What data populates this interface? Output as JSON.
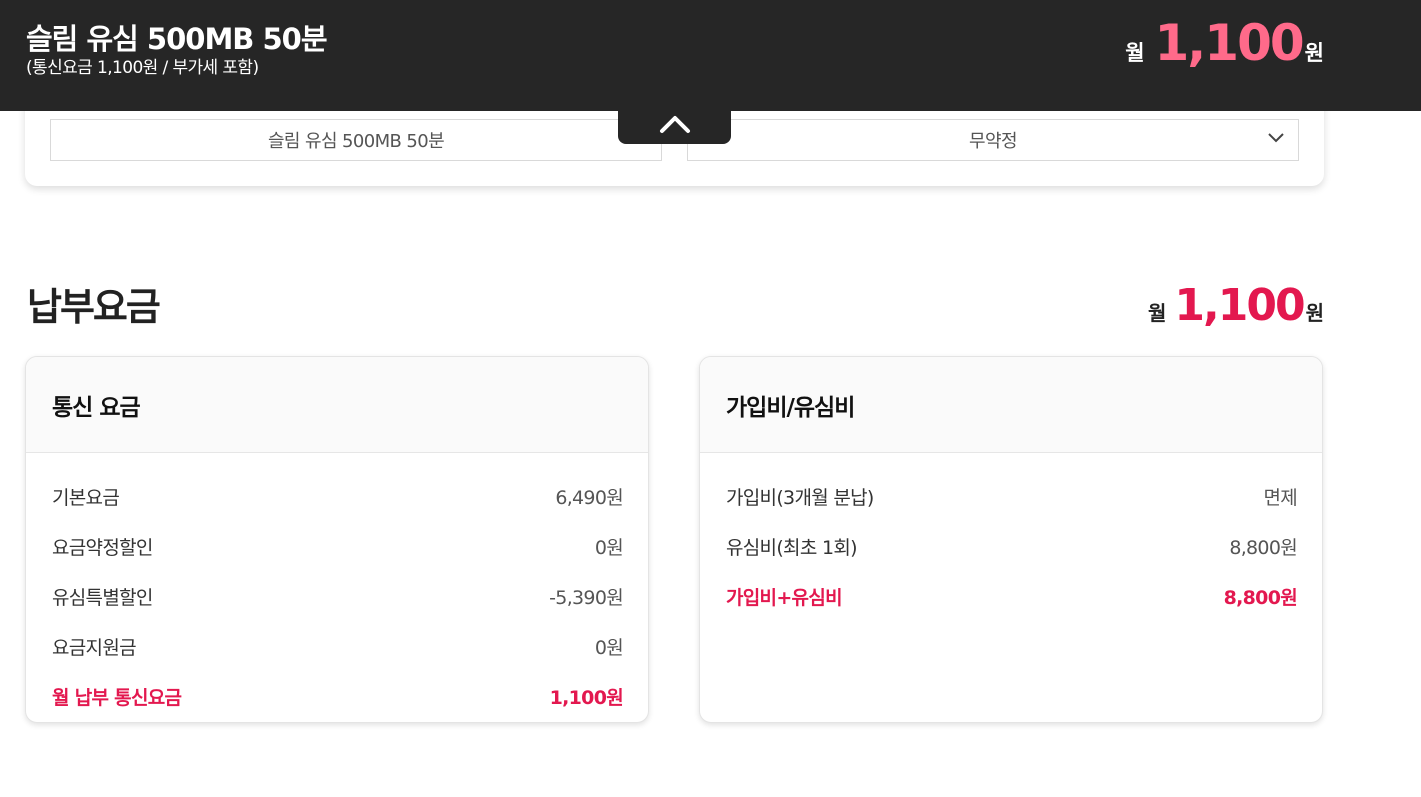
{
  "topbar": {
    "plan_name": "슬림 유심 500MB 50분",
    "plan_sub": "(통신요금 1,100원 / 부가세 포함)",
    "price_prefix": "월",
    "price_amount": "1,100",
    "price_unit": "원"
  },
  "selectors": {
    "plan": "슬림 유심 500MB 50분",
    "contract": "무약정"
  },
  "payment": {
    "title": "납부요금",
    "price_prefix": "월",
    "price_amount": "1,100",
    "price_unit": "원"
  },
  "telecom_card": {
    "title": "통신 요금",
    "rows": [
      {
        "label": "기본요금",
        "value": "6,490원"
      },
      {
        "label": "요금약정할인",
        "value": "0원"
      },
      {
        "label": "유심특별할인",
        "value": "-5,390원"
      },
      {
        "label": "요금지원금",
        "value": "0원"
      }
    ],
    "total": {
      "label": "월 납부 통신요금",
      "value": "1,100원"
    }
  },
  "fee_card": {
    "title": "가입비/유심비",
    "rows": [
      {
        "label": "가입비(3개월 분납)",
        "value": "면제"
      },
      {
        "label": "유심비(최초 1회)",
        "value": "8,800원"
      }
    ],
    "total": {
      "label": "가입비+유심비",
      "value": "8,800원"
    }
  },
  "colors": {
    "accent": "#e3184f",
    "topbar_accent": "#ff6a8a",
    "topbar_bg": "#262626"
  }
}
